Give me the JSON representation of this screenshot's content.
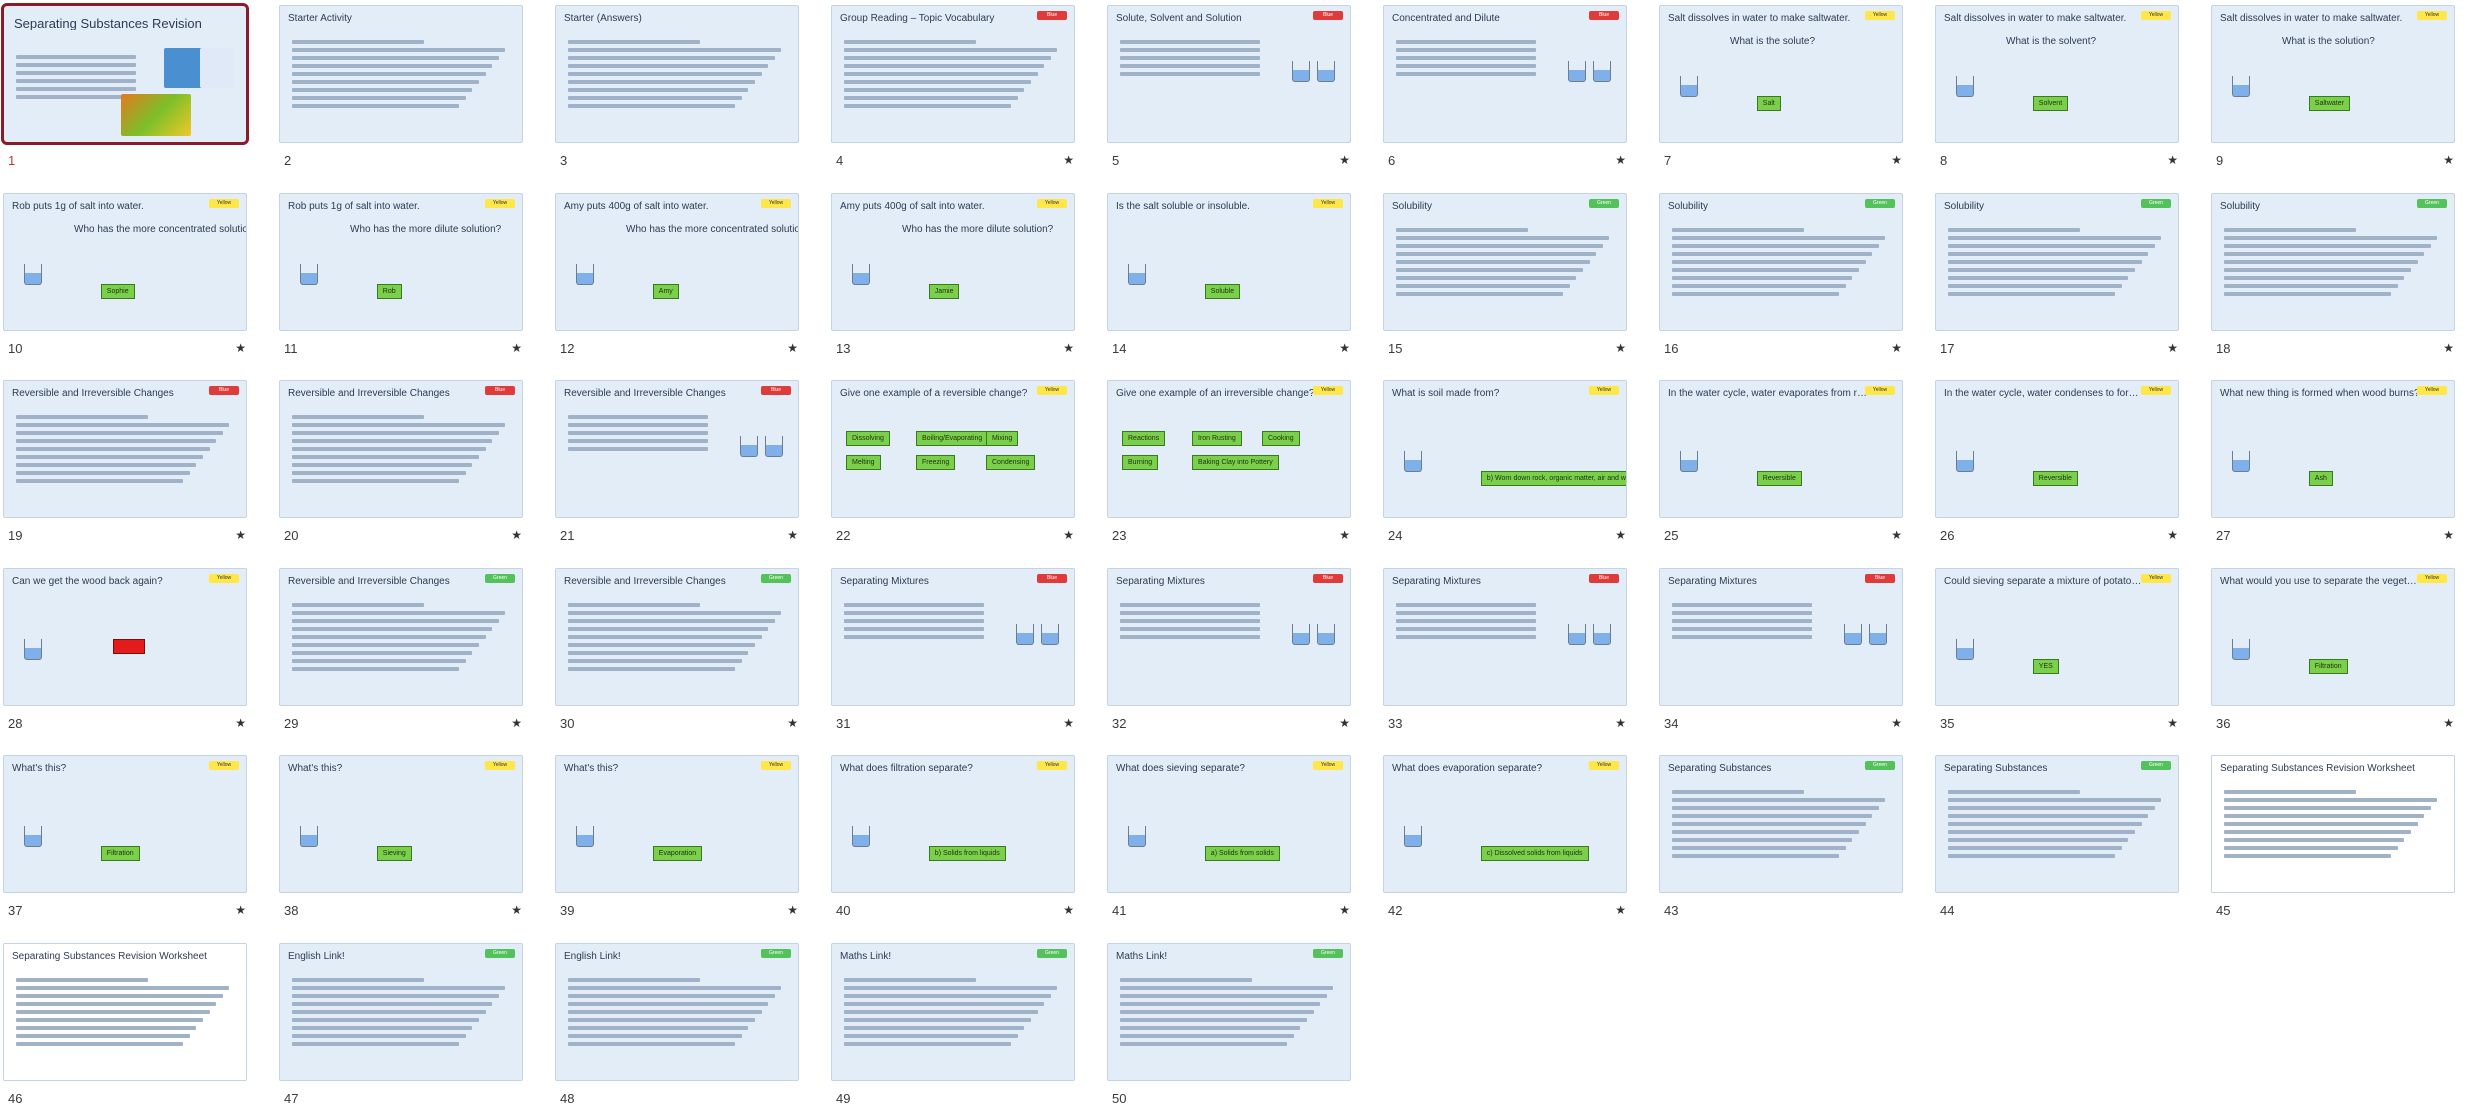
{
  "slides": [
    {
      "num": "1",
      "title": "Separating Substances Revision",
      "tag": "",
      "star": false,
      "selected": true,
      "kind": "title"
    },
    {
      "num": "2",
      "title": "Starter Activity",
      "tag": "",
      "star": false,
      "kind": "text"
    },
    {
      "num": "3",
      "title": "Starter (Answers)",
      "tag": "",
      "star": false,
      "kind": "text"
    },
    {
      "num": "4",
      "title": "Group Reading – Topic Vocabulary",
      "tag": "red",
      "star": true,
      "kind": "text"
    },
    {
      "num": "5",
      "title": "Solute, Solvent and Solution",
      "tag": "red",
      "star": true,
      "kind": "diagram"
    },
    {
      "num": "6",
      "title": "Concentrated and Dilute",
      "tag": "red",
      "star": true,
      "kind": "diagram"
    },
    {
      "num": "7",
      "title": "Salt dissolves in water to make saltwater.",
      "question": "What is the solute?",
      "answer": "Salt",
      "tag": "yellow",
      "star": true,
      "kind": "qa"
    },
    {
      "num": "8",
      "title": "Salt dissolves in water to make saltwater.",
      "question": "What is the solvent?",
      "answer": "Solvent",
      "tag": "yellow",
      "star": true,
      "kind": "qa"
    },
    {
      "num": "9",
      "title": "Salt dissolves in water to make saltwater.",
      "question": "What is the solution?",
      "answer": "Saltwater",
      "tag": "yellow",
      "star": true,
      "kind": "qa"
    },
    {
      "num": "10",
      "title": "Rob puts 1g of salt into water.",
      "question": "Who has the more concentrated solution?",
      "answer": "Sophie",
      "tag": "yellow",
      "star": true,
      "kind": "qa"
    },
    {
      "num": "11",
      "title": "Rob puts 1g of salt into water.",
      "question": "Who has the more dilute solution?",
      "answer": "Rob",
      "tag": "yellow",
      "star": true,
      "kind": "qa"
    },
    {
      "num": "12",
      "title": "Amy puts 400g of salt into water.",
      "question": "Who has the more concentrated solution?",
      "answer": "Amy",
      "tag": "yellow",
      "star": true,
      "kind": "qa"
    },
    {
      "num": "13",
      "title": "Amy puts 400g of salt into water.",
      "question": "Who has the more dilute solution?",
      "answer": "Jamie",
      "tag": "yellow",
      "star": true,
      "kind": "qa"
    },
    {
      "num": "14",
      "title": "Is the salt soluble or insoluble.",
      "question": "",
      "answer": "Soluble",
      "tag": "yellow",
      "star": true,
      "kind": "qa"
    },
    {
      "num": "15",
      "title": "Solubility",
      "tag": "green",
      "star": true,
      "kind": "text"
    },
    {
      "num": "16",
      "title": "Solubility",
      "tag": "green",
      "star": true,
      "kind": "text"
    },
    {
      "num": "17",
      "title": "Solubility",
      "tag": "green",
      "star": true,
      "kind": "text"
    },
    {
      "num": "18",
      "title": "Solubility",
      "tag": "green",
      "star": true,
      "kind": "text"
    },
    {
      "num": "19",
      "title": "Reversible and Irreversible Changes",
      "tag": "red",
      "star": true,
      "kind": "text"
    },
    {
      "num": "20",
      "title": "Reversible and Irreversible Changes",
      "tag": "red",
      "star": true,
      "kind": "text"
    },
    {
      "num": "21",
      "title": "Reversible and Irreversible Changes",
      "tag": "red",
      "star": true,
      "kind": "diagram"
    },
    {
      "num": "22",
      "title": "Give one example of a reversible change?",
      "tag": "yellow",
      "star": true,
      "kind": "chips",
      "chips": [
        "Dissolving",
        "Boiling/Evaporating",
        "Mixing",
        "Melting",
        "Freezing",
        "Condensing"
      ]
    },
    {
      "num": "23",
      "title": "Give one example of an irreversible change?",
      "tag": "yellow",
      "star": true,
      "kind": "chips",
      "chips": [
        "Reactions",
        "Iron Rusting",
        "Cooking",
        "Burning",
        "Baking Clay into Pottery"
      ]
    },
    {
      "num": "24",
      "title": "What is soil made from?",
      "question": "",
      "answer": "b) Worn down rock, organic matter, air and water",
      "tag": "yellow",
      "star": true,
      "kind": "qa"
    },
    {
      "num": "25",
      "title": "In the water cycle, water evaporates from rivers, lakes and the sea. Is this reversible or irreversible?",
      "question": "",
      "answer": "Reversible",
      "tag": "yellow",
      "star": true,
      "kind": "qa"
    },
    {
      "num": "26",
      "title": "In the water cycle, water condenses to form clouds and falls as rain. Is this condensing reversible or irreversible?",
      "question": "",
      "answer": "Reversible",
      "tag": "yellow",
      "star": true,
      "kind": "qa"
    },
    {
      "num": "27",
      "title": "What new thing is formed when wood burns?",
      "question": "",
      "answer": "Ash",
      "tag": "yellow",
      "star": true,
      "kind": "qa"
    },
    {
      "num": "28",
      "title": "Can we get the wood back again?",
      "question": "",
      "answer": "",
      "tag": "yellow",
      "star": true,
      "kind": "qa"
    },
    {
      "num": "29",
      "title": "Reversible and Irreversible Changes",
      "tag": "green",
      "star": true,
      "kind": "text"
    },
    {
      "num": "30",
      "title": "Reversible and Irreversible Changes",
      "tag": "green",
      "star": true,
      "kind": "text"
    },
    {
      "num": "31",
      "title": "Separating Mixtures",
      "tag": "red",
      "star": true,
      "kind": "diagram"
    },
    {
      "num": "32",
      "title": "Separating Mixtures",
      "tag": "red",
      "star": true,
      "kind": "diagram"
    },
    {
      "num": "33",
      "title": "Separating Mixtures",
      "tag": "red",
      "star": true,
      "kind": "diagram"
    },
    {
      "num": "34",
      "title": "Separating Mixtures",
      "tag": "red",
      "star": true,
      "kind": "diagram"
    },
    {
      "num": "35",
      "title": "Could sieving separate a mixture of potatoes and rice?",
      "question": "",
      "answer": "YES",
      "tag": "yellow",
      "star": true,
      "kind": "qa"
    },
    {
      "num": "36",
      "title": "What would you use to separate the vegetables from the gravy?",
      "question": "",
      "answer": "Filtration",
      "tag": "yellow",
      "star": true,
      "kind": "qa"
    },
    {
      "num": "37",
      "title": "What's this?",
      "question": "",
      "answer": "Filtration",
      "tag": "yellow",
      "star": true,
      "kind": "qa"
    },
    {
      "num": "38",
      "title": "What's this?",
      "question": "",
      "answer": "Sieving",
      "tag": "yellow",
      "star": true,
      "kind": "qa"
    },
    {
      "num": "39",
      "title": "What's this?",
      "question": "",
      "answer": "Evaporation",
      "tag": "yellow",
      "star": true,
      "kind": "qa"
    },
    {
      "num": "40",
      "title": "What does filtration separate?",
      "question": "",
      "answer": "b) Solids from liquids",
      "tag": "yellow",
      "star": true,
      "kind": "qa"
    },
    {
      "num": "41",
      "title": "What does sieving separate?",
      "question": "",
      "answer": "a) Solids from solids",
      "tag": "yellow",
      "star": true,
      "kind": "qa"
    },
    {
      "num": "42",
      "title": "What does evaporation separate?",
      "question": "",
      "answer": "c) Dissolved solids from liquids",
      "tag": "yellow",
      "star": true,
      "kind": "qa"
    },
    {
      "num": "43",
      "title": "Separating Substances",
      "tag": "green",
      "star": false,
      "kind": "text"
    },
    {
      "num": "44",
      "title": "Separating Substances",
      "tag": "green",
      "star": false,
      "kind": "text"
    },
    {
      "num": "45",
      "title": "Separating Substances Revision Worksheet",
      "tag": "",
      "star": false,
      "white": true,
      "kind": "worksheet"
    },
    {
      "num": "46",
      "title": "Separating Substances Revision Worksheet",
      "tag": "",
      "star": false,
      "white": true,
      "kind": "worksheet"
    },
    {
      "num": "47",
      "title": "English Link!",
      "tag": "green",
      "star": false,
      "kind": "text"
    },
    {
      "num": "48",
      "title": "English Link!",
      "tag": "green",
      "star": false,
      "kind": "text"
    },
    {
      "num": "49",
      "title": "Maths Link!",
      "tag": "green",
      "star": false,
      "kind": "text"
    },
    {
      "num": "50",
      "title": "Maths Link!",
      "tag": "green",
      "star": false,
      "kind": "text"
    }
  ],
  "tag_labels": {
    "red": "Blue",
    "yellow": "Yellow",
    "green": "Green"
  },
  "star_glyph": "★",
  "colors": {
    "answer": "#7bd04b",
    "selected_border": "#8b1a2a",
    "slide_bg": "#e3edf8"
  }
}
